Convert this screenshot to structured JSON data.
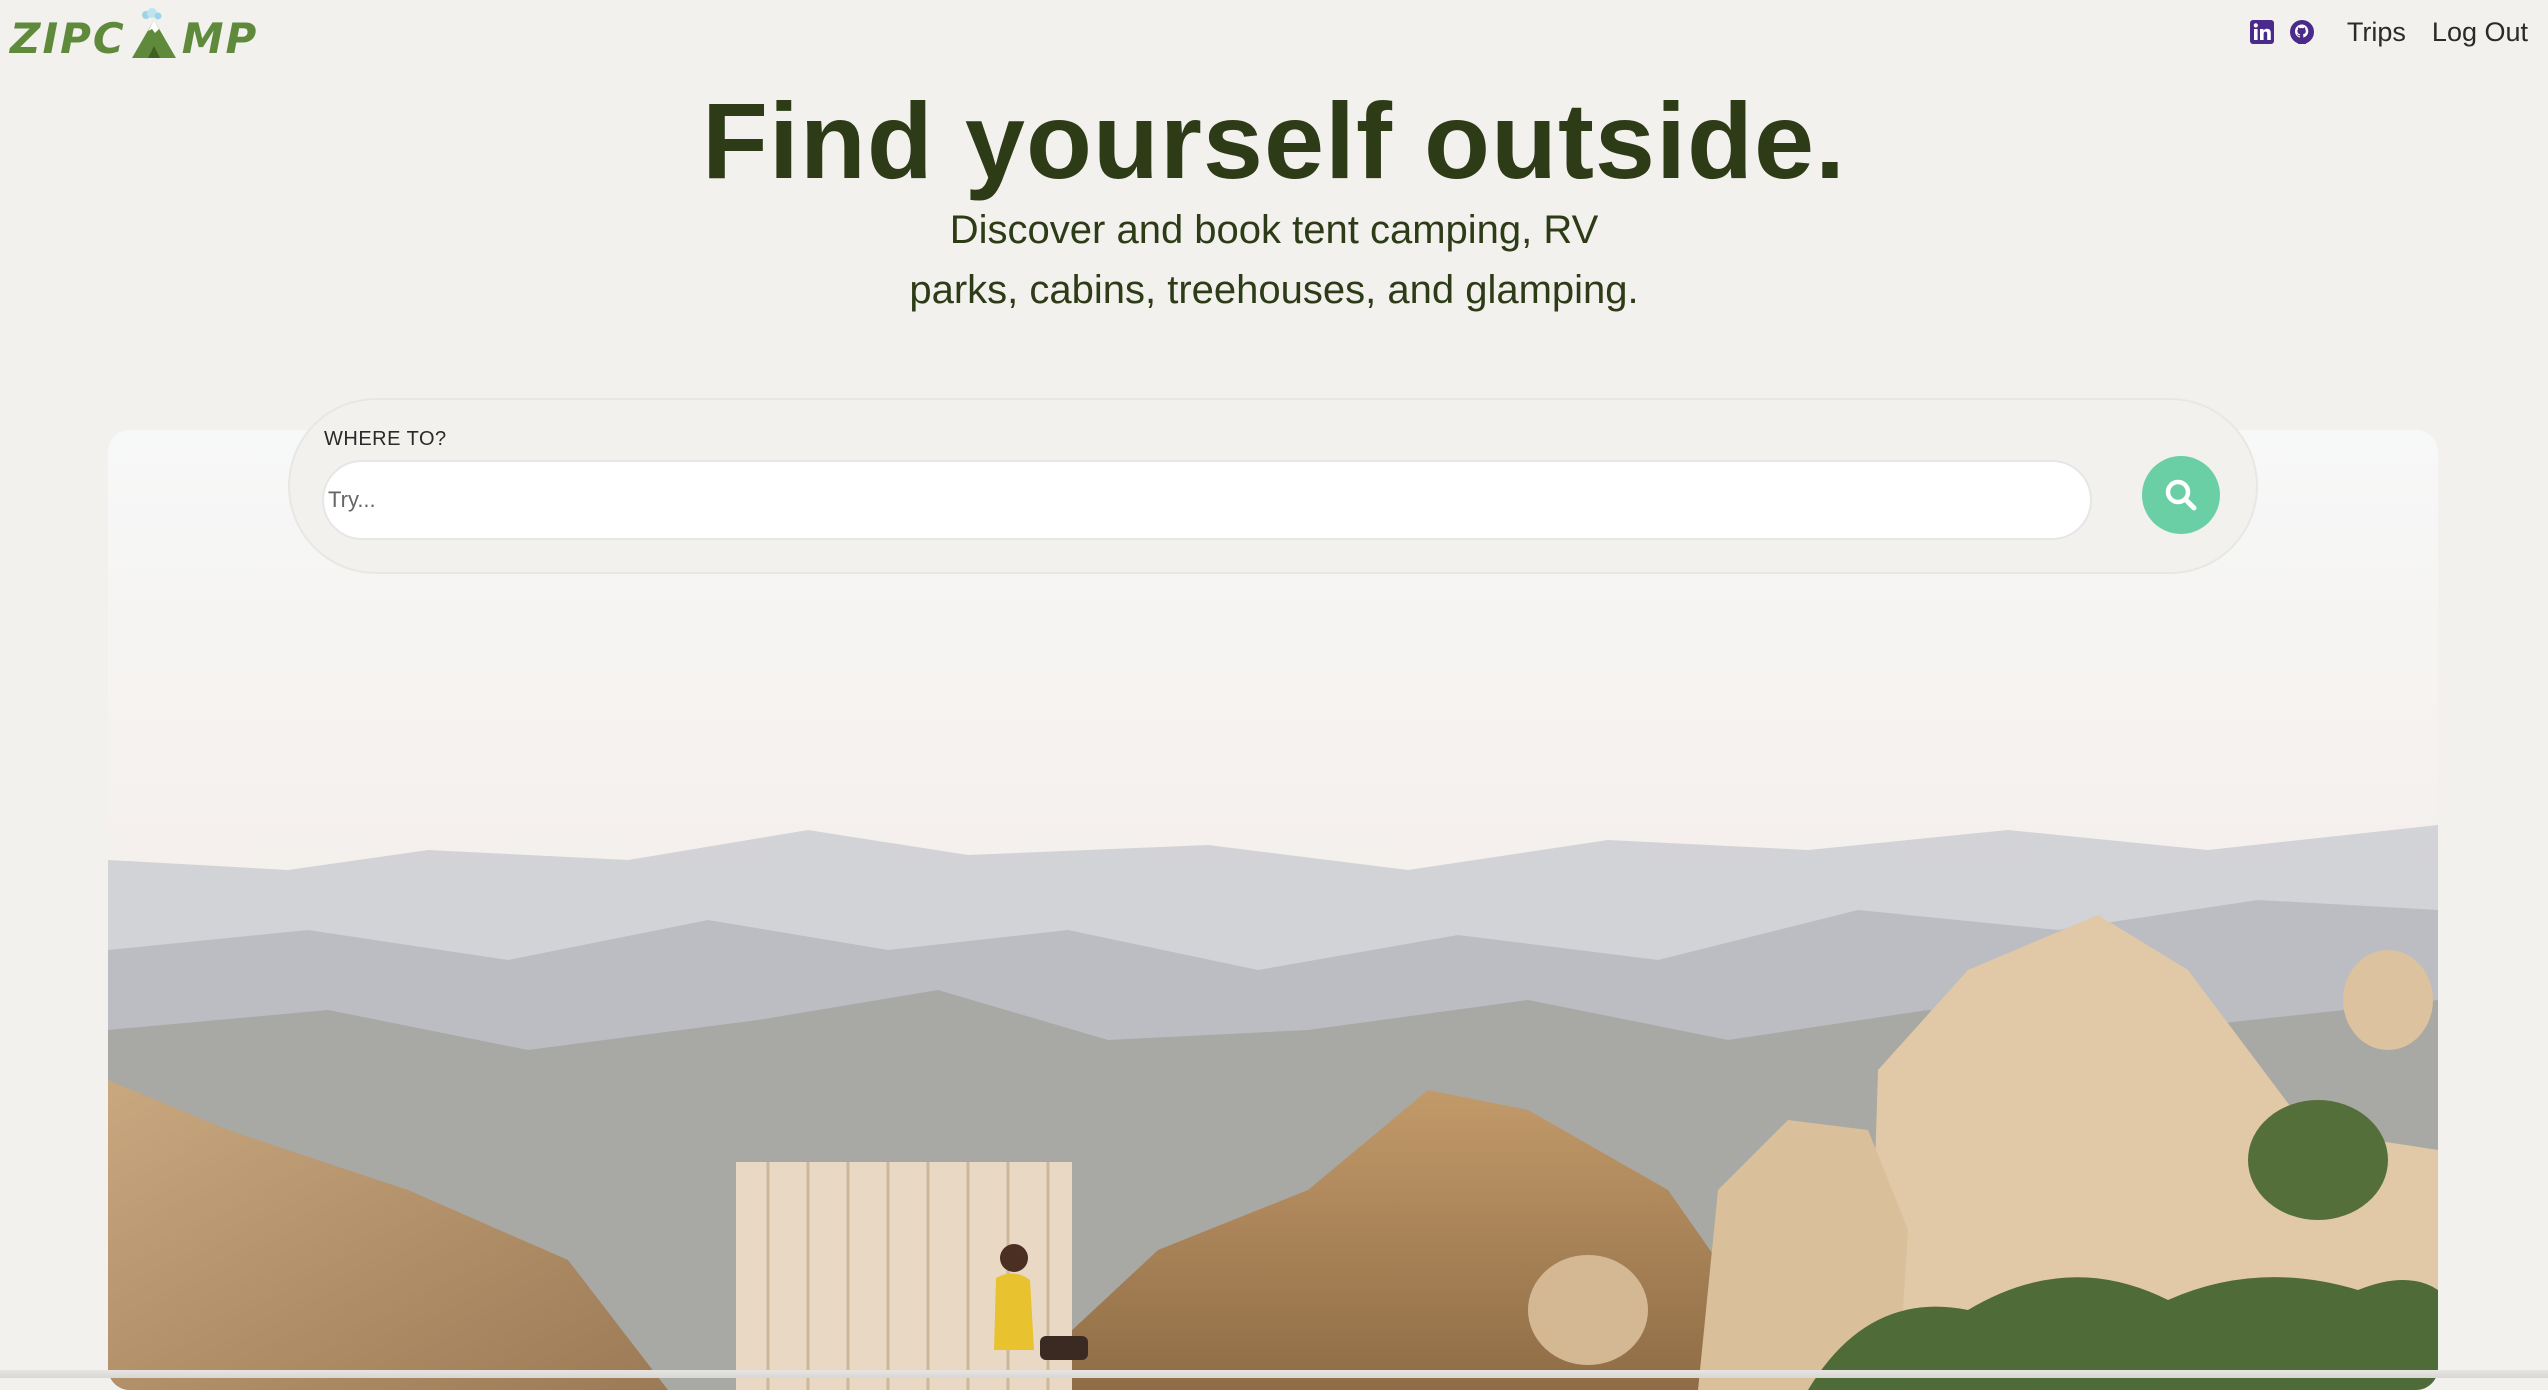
{
  "header": {
    "logo_text_left": "ZIPC",
    "logo_text_right": "MP",
    "nav": {
      "linkedin_icon": "linkedin-icon",
      "github_icon": "github-icon",
      "trips_label": "Trips",
      "logout_label": "Log Out"
    }
  },
  "hero": {
    "title": "Find yourself outside.",
    "subtitle_line1": "Discover and book tent camping, RV",
    "subtitle_line2": "parks, cabins, treehouses, and glamping."
  },
  "search": {
    "label": "WHERE TO?",
    "placeholder": "Try...",
    "value": "",
    "button_icon": "search-icon"
  },
  "colors": {
    "background": "#f2f1ee",
    "title": "#2d3b16",
    "brand_green": "#5f8a3c",
    "search_button": "#6bcfa5",
    "icon_purple": "#4a2a8a"
  }
}
